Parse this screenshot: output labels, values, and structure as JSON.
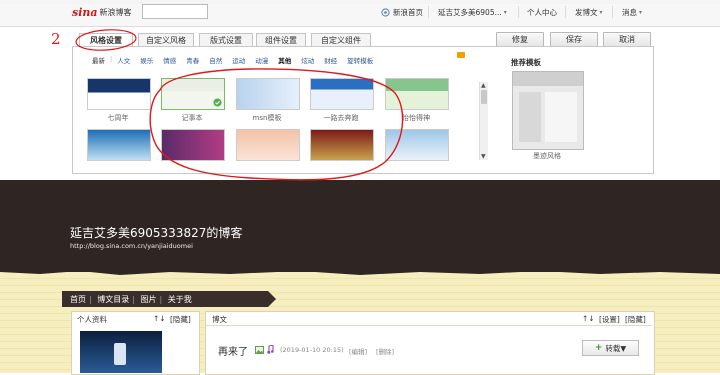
{
  "topbar": {
    "logo_mark": "sina",
    "logo_text": "新浪博客",
    "nav": [
      "新浪首页",
      "延吉艾多美6905...",
      "个人中心",
      "发博文",
      "消息"
    ]
  },
  "annotation": {
    "number": "2"
  },
  "tabs": [
    "风格设置",
    "自定义风格",
    "版式设置",
    "组件设置",
    "自定义组件"
  ],
  "actions": {
    "save_label": "保存",
    "cancel_label": "取消",
    "restore_label": "修复"
  },
  "categories": [
    "最新",
    "人文",
    "娱乐",
    "情感",
    "青春",
    "自然",
    "运动",
    "动漫",
    "其他",
    "炫动",
    "财经",
    "旋转模板"
  ],
  "templates": [
    {
      "label": "七周年",
      "colors": [
        "#16356a",
        "#ffffff"
      ]
    },
    {
      "label": "记事本",
      "colors": [
        "#e9efe4",
        "#f3f6ee"
      ],
      "selected": true
    },
    {
      "label": "msn模板",
      "colors": [
        "#b8d2ee",
        "#e6f0fa"
      ]
    },
    {
      "label": "一路去奔跑",
      "colors": [
        "#2a6fc1",
        "#e8f1fb"
      ]
    },
    {
      "label": "怡怡得神",
      "colors": [
        "#86c58e",
        "#e3f2d8"
      ]
    },
    {
      "label": "",
      "colors": [
        "#1e6eb5",
        "#bfe0f2"
      ]
    },
    {
      "label": "",
      "colors": [
        "#5a2a6a",
        "#b13d84"
      ]
    },
    {
      "label": "",
      "colors": [
        "#f2c3a8",
        "#fbe3d6"
      ]
    },
    {
      "label": "",
      "colors": [
        "#7c1a1a",
        "#c9a24a"
      ]
    },
    {
      "label": "",
      "colors": [
        "#9fc7e6",
        "#e9f2f9"
      ]
    }
  ],
  "recommend": {
    "title": "推荐模板",
    "label": "墨迹风格"
  },
  "blog": {
    "title": "延吉艾多美6905333827的博客",
    "url": "http://blog.sina.com.cn/yanjiaiduomei"
  },
  "blognav": [
    "首页",
    "博文目录",
    "图片",
    "关于我"
  ],
  "profile": {
    "title": "个人资料",
    "arrows": "↑↓",
    "hide": "[隐藏]"
  },
  "posts": {
    "title": "博文",
    "arrows": "↑↓",
    "settings": "[设置]",
    "hide": "[隐藏]",
    "post_title": "再来了",
    "post_meta": "(2019-01-10 20:15)",
    "edit": "[编辑]",
    "delete": "[删除]",
    "forward": "转载▼"
  }
}
